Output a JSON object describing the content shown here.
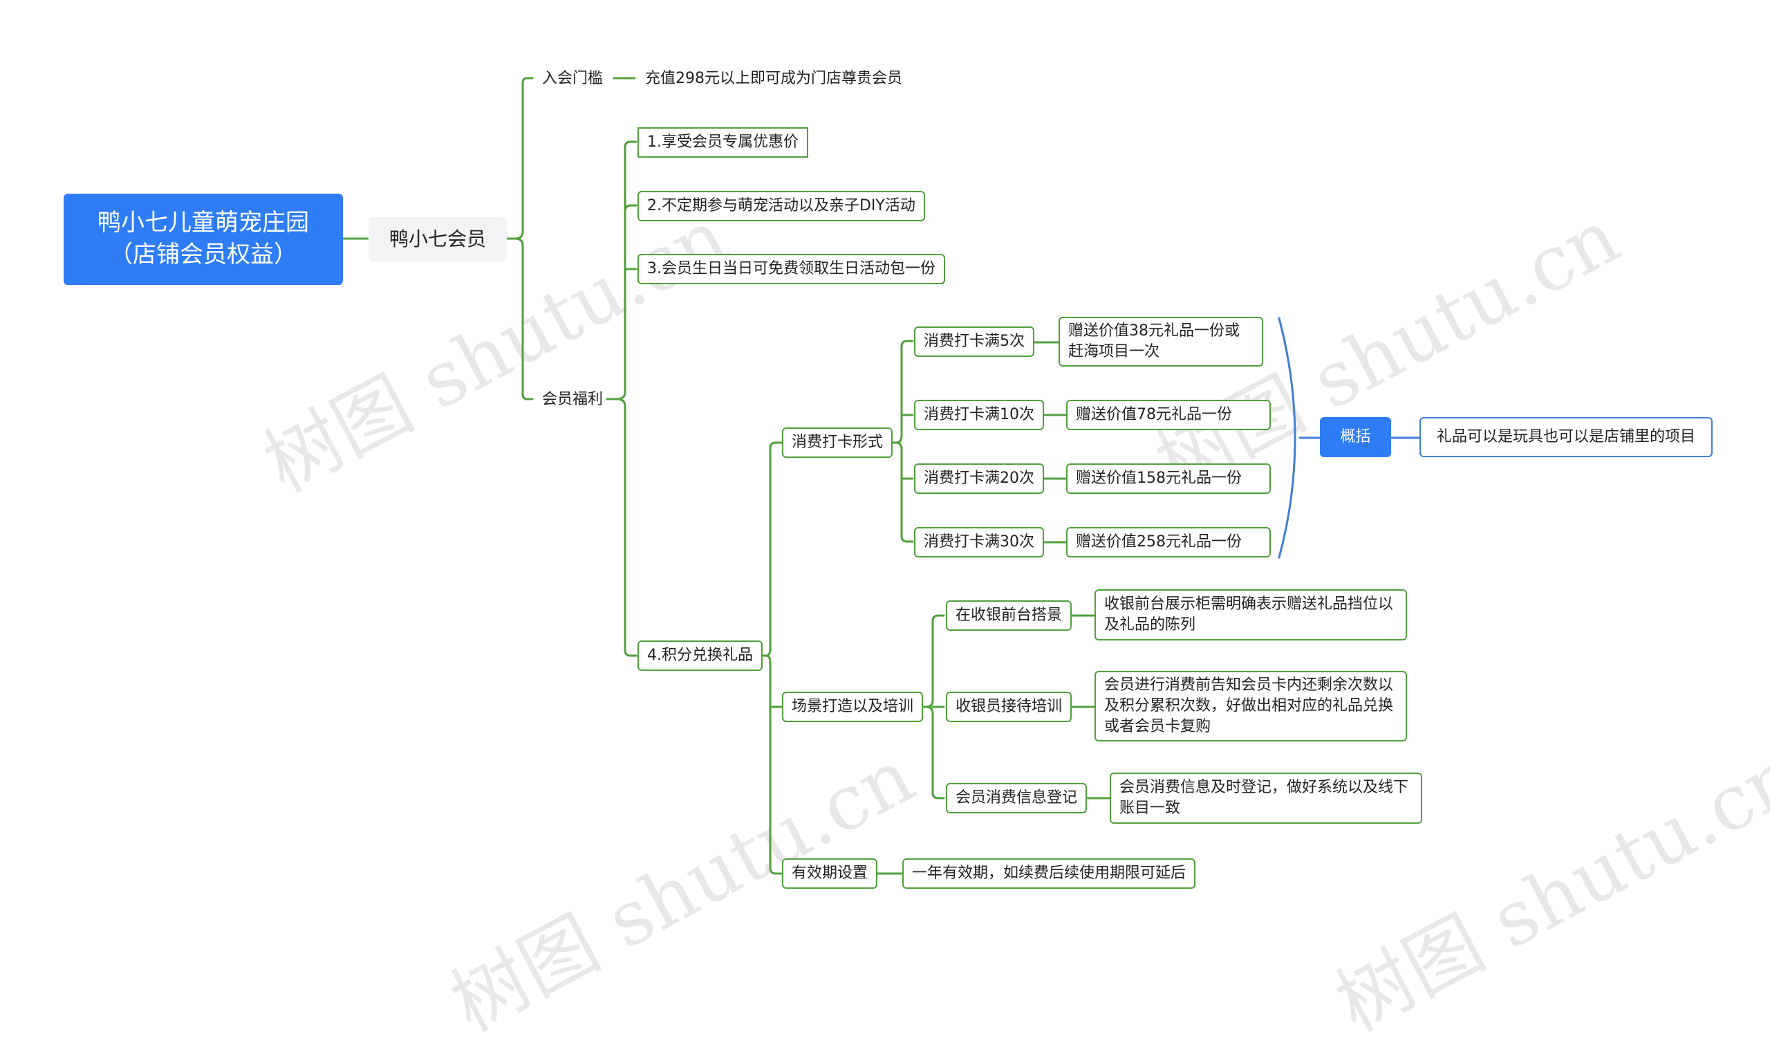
{
  "root": {
    "line1": "鸭小七儿童萌宠庄园",
    "line2": "（店铺会员权益）"
  },
  "main": "鸭小七会员",
  "threshold": {
    "label": "入会门槛",
    "value": "充值298元以上即可成为门店尊贵会员"
  },
  "benefits": {
    "label": "会员福利",
    "items": [
      "1.享受会员专属优惠价",
      "2.不定期参与萌宠活动以及亲子DIY活动",
      "3.会员生日当日可免费领取生日活动包一份",
      "4.积分兑换礼品"
    ]
  },
  "points": {
    "checkin": {
      "label": "消费打卡形式",
      "tiers": [
        {
          "label": "消费打卡满5次",
          "reward": "赠送价值38元礼品一份或赶海项目一次"
        },
        {
          "label": "消费打卡满10次",
          "reward": "赠送价值78元礼品一份"
        },
        {
          "label": "消费打卡满20次",
          "reward": "赠送价值158元礼品一份"
        },
        {
          "label": "消费打卡满30次",
          "reward": "赠送价值258元礼品一份"
        }
      ],
      "summary": {
        "label": "概括",
        "text": "礼品可以是玩具也可以是店铺里的项目"
      }
    },
    "scene": {
      "label": "场景打造以及培训",
      "items": [
        {
          "label": "在收银前台搭景",
          "detail": "收银前台展示柜需明确表示赠送礼品挡位以及礼品的陈列"
        },
        {
          "label": "收银员接待培训",
          "detail": "会员进行消费前告知会员卡内还剩余次数以及积分累积次数，好做出相对应的礼品兑换或者会员卡复购"
        },
        {
          "label": "会员消费信息登记",
          "detail": "会员消费信息及时登记，做好系统以及线下账目一致"
        }
      ]
    },
    "validity": {
      "label": "有效期设置",
      "detail": "一年有效期，如续费后续使用期限可延后"
    }
  },
  "watermark": "树图 shutu.cn",
  "colors": {
    "root": "#2f7df6",
    "line": "#4fa03a",
    "summary_line": "#3f7fd6"
  }
}
